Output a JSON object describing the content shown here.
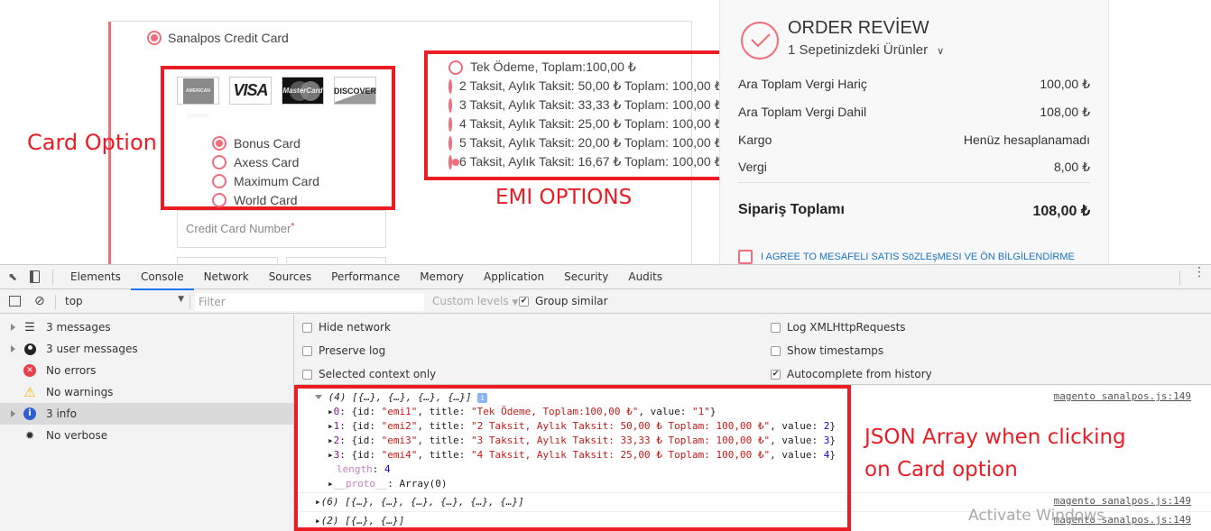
{
  "payment": {
    "method_label": "Sanalpos Credit Card",
    "method_selected": true,
    "card_logos": [
      "AMERICAN EXPRESS",
      "VISA",
      "MasterCard",
      "DISCOVER"
    ],
    "card_options": [
      {
        "label": "Bonus Card",
        "selected": true
      },
      {
        "label": "Axess Card",
        "selected": false
      },
      {
        "label": "Maximum Card",
        "selected": false
      },
      {
        "label": "World Card",
        "selected": false
      }
    ],
    "cc_number_placeholder": "Credit Card Number",
    "required_mark": "*",
    "emi_options": [
      {
        "label": "Tek Ödeme, Toplam:100,00 ₺",
        "selected": false
      },
      {
        "label": "2 Taksit, Aylık Taksit: 50,00 ₺ Toplam: 100,00 ₺",
        "selected": false
      },
      {
        "label": "3 Taksit, Aylık Taksit: 33,33 ₺ Toplam: 100,00 ₺",
        "selected": false
      },
      {
        "label": "4 Taksit, Aylık Taksit: 25,00 ₺ Toplam: 100,00 ₺",
        "selected": false
      },
      {
        "label": "5 Taksit, Aylık Taksit: 20,00 ₺ Toplam: 100,00 ₺",
        "selected": false
      },
      {
        "label": "6 Taksit, Aylık Taksit: 16,67 ₺ Toplam: 100,00 ₺",
        "selected": true
      }
    ]
  },
  "annotations": {
    "card_option": "Card Option",
    "emi_options": "EMI OPTIONS",
    "json_array_line1": "JSON Array when clicking",
    "json_array_line2": "on Card option",
    "color": "#ec1c24"
  },
  "order_review": {
    "title": "ORDER REVİEW",
    "items_toggle": "1 Sepetinizdeki Ürünler",
    "rows": [
      {
        "label": "Ara Toplam Vergi Hariç",
        "value": "100,00 ₺"
      },
      {
        "label": "Ara Toplam Vergi Dahil",
        "value": "108,00 ₺"
      },
      {
        "label": "Kargo",
        "value": "Henüz hesaplanamadı"
      },
      {
        "label": "Vergi",
        "value": "8,00 ₺"
      }
    ],
    "total_label": "Sipariş Toplamı",
    "total_value": "108,00 ₺",
    "agree_label": "I AGREE TO MESAFELI SATIS SöZLEşMESI VE ÖN BİLGİLENDİRME",
    "accent": "#f06e7c"
  },
  "devtools": {
    "tabs": [
      "Elements",
      "Console",
      "Network",
      "Sources",
      "Performance",
      "Memory",
      "Application",
      "Security",
      "Audits"
    ],
    "active_tab": "Console",
    "context": "top",
    "filter_placeholder": "Filter",
    "levels": "Custom levels",
    "group_similar": {
      "label": "Group similar",
      "checked": true
    },
    "sidebar": [
      {
        "label": "3 messages",
        "icon": "list-icon",
        "expandable": true
      },
      {
        "label": "3 user messages",
        "icon": "user-icon",
        "expandable": true
      },
      {
        "label": "No errors",
        "icon": "error-icon",
        "expandable": false
      },
      {
        "label": "No warnings",
        "icon": "warning-icon",
        "expandable": false
      },
      {
        "label": "3 info",
        "icon": "info-icon",
        "expandable": true,
        "selected": true
      },
      {
        "label": "No verbose",
        "icon": "bug-icon",
        "expandable": false
      }
    ],
    "settings_left": [
      {
        "label": "Hide network",
        "checked": false
      },
      {
        "label": "Preserve log",
        "checked": false
      },
      {
        "label": "Selected context only",
        "checked": false
      }
    ],
    "settings_right": [
      {
        "label": "Log XMLHttpRequests",
        "checked": false
      },
      {
        "label": "Show timestamps",
        "checked": false
      },
      {
        "label": "Autocomplete from history",
        "checked": true
      }
    ],
    "console": {
      "source": "magento sanalpos.js:149",
      "entry1_header": "(4) [{…}, {…}, {…}, {…}]",
      "entry1_items": [
        {
          "index": "0",
          "id": "\"emi1\"",
          "title": "\"Tek Ödeme, Toplam:100,00 ₺\"",
          "value": "\"1\"",
          "value_is_string": true
        },
        {
          "index": "1",
          "id": "\"emi2\"",
          "title": "\"2 Taksit, Aylık Taksit: 50,00 ₺ Toplam: 100,00 ₺\"",
          "value": "2",
          "value_is_string": false
        },
        {
          "index": "2",
          "id": "\"emi3\"",
          "title": "\"3 Taksit, Aylık Taksit: 33,33 ₺ Toplam: 100,00 ₺\"",
          "value": "3",
          "value_is_string": false
        },
        {
          "index": "3",
          "id": "\"emi4\"",
          "title": "\"4 Taksit, Aylık Taksit: 25,00 ₺ Toplam: 100,00 ₺\"",
          "value": "4",
          "value_is_string": false
        }
      ],
      "length_key": "length",
      "length_value": "4",
      "proto_key": "__proto__",
      "proto_value": "Array(0)",
      "entry2_header": "(6) [{…}, {…}, {…}, {…}, {…}, {…}]",
      "entry3_header": "(2) [{…}, {…}]"
    }
  },
  "watermark": "Activate Windows"
}
